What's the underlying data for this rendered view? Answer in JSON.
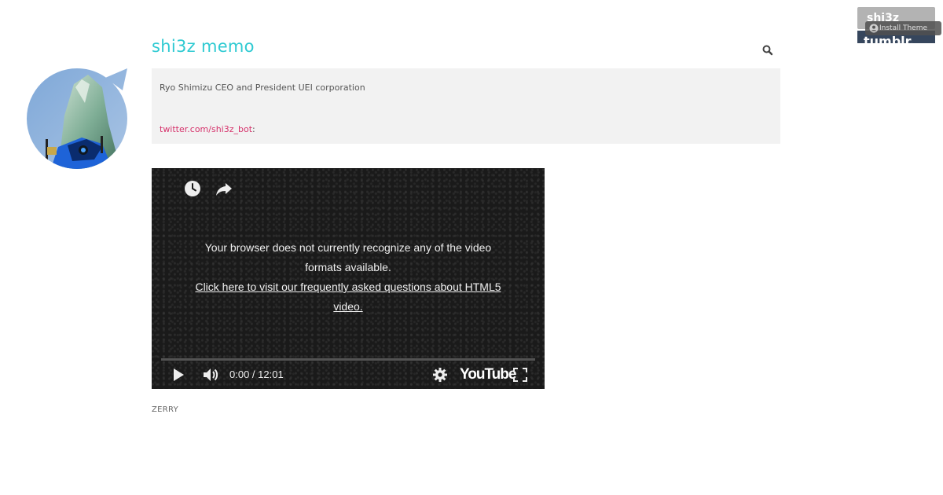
{
  "tumblr_controls": {
    "follow_label": "shi3z",
    "install_theme_label": "Install Theme",
    "brand_label": "tumblr."
  },
  "avatar": {
    "icon": "avatar-photo"
  },
  "header": {
    "title": "shi3z memo",
    "search_icon": "search-icon"
  },
  "description": {
    "text": "Ryo Shimizu CEO and President UEI corporation",
    "twitter_link": "twitter.com/shi3z_bot",
    "twitter_suffix": ":"
  },
  "video": {
    "top_icons": [
      "watch-later-icon",
      "share-icon"
    ],
    "error_message": "Your browser does not currently recognize any of the video formats available.",
    "faq_link": "Click here to visit our frequently asked questions about HTML5 video.",
    "time_display": "0:00 / 12:01",
    "progress_fraction": 0.0,
    "youtube_label": "YouTube"
  },
  "post": {
    "tag": "ZERRY"
  },
  "colors": {
    "title_accent": "#2ecad2",
    "link_pink": "#d6336c",
    "desc_bg": "#f2f2f2",
    "video_bg": "#1a1a1a",
    "tumblr_navy": "#36465d"
  }
}
